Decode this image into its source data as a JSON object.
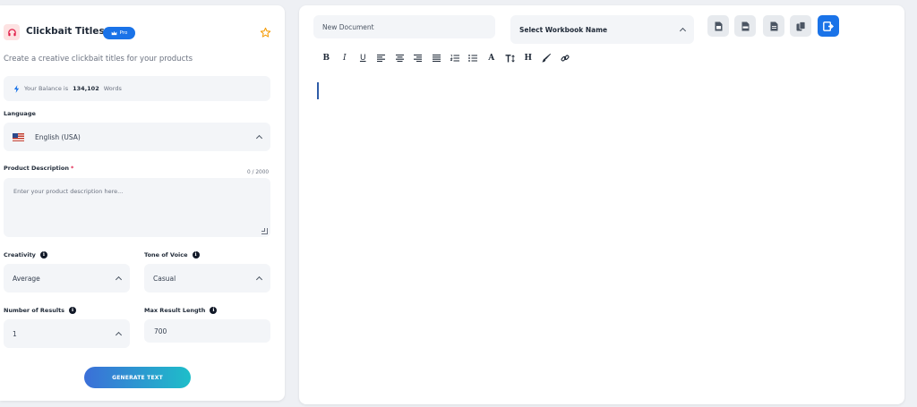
{
  "left": {
    "title": "Clickbait Titles",
    "badge": "Pro",
    "subtitle": "Create a creative clickbait titles for your products",
    "balance": {
      "prefix": "Your Balance is",
      "amount": "134,102",
      "unit": "Words"
    },
    "language": {
      "label": "Language",
      "value": "English (USA)"
    },
    "description": {
      "label": "Product Description",
      "required_mark": "*",
      "counter": "0 / 2000",
      "placeholder": "Enter your product description here..."
    },
    "creativity": {
      "label": "Creativity",
      "value": "Average"
    },
    "tone": {
      "label": "Tone of Voice",
      "value": "Casual"
    },
    "results": {
      "label": "Number of Results",
      "value": "1"
    },
    "max_length": {
      "label": "Max Result Length",
      "value": "700"
    },
    "generate_label": "GENERATE TEXT"
  },
  "editor": {
    "document_name": "New Document",
    "workbook_select": "Select Workbook Name",
    "toolbar": {
      "bold": "B",
      "italic": "I",
      "underline": "U",
      "font_color": "A",
      "heading": "H"
    }
  },
  "colors": {
    "accent": "#1a73e8",
    "star": "#f59e0b",
    "required": "#e11d48",
    "field_bg": "#f3f5f8"
  },
  "icons": [
    "headphones-icon",
    "crown-icon",
    "star-icon",
    "bolt-icon",
    "us-flag-icon",
    "info-icon",
    "chevron-up-icon",
    "resize-handle-icon",
    "doc-icon",
    "pdf-icon",
    "txt-icon",
    "copy-icon",
    "save-icon",
    "bold-icon",
    "italic-icon",
    "underline-icon",
    "align-left-icon",
    "align-center-icon",
    "align-right-icon",
    "align-justify-icon",
    "ordered-list-icon",
    "unordered-list-icon",
    "font-color-icon",
    "text-height-icon",
    "heading-icon",
    "brush-icon",
    "link-icon"
  ]
}
